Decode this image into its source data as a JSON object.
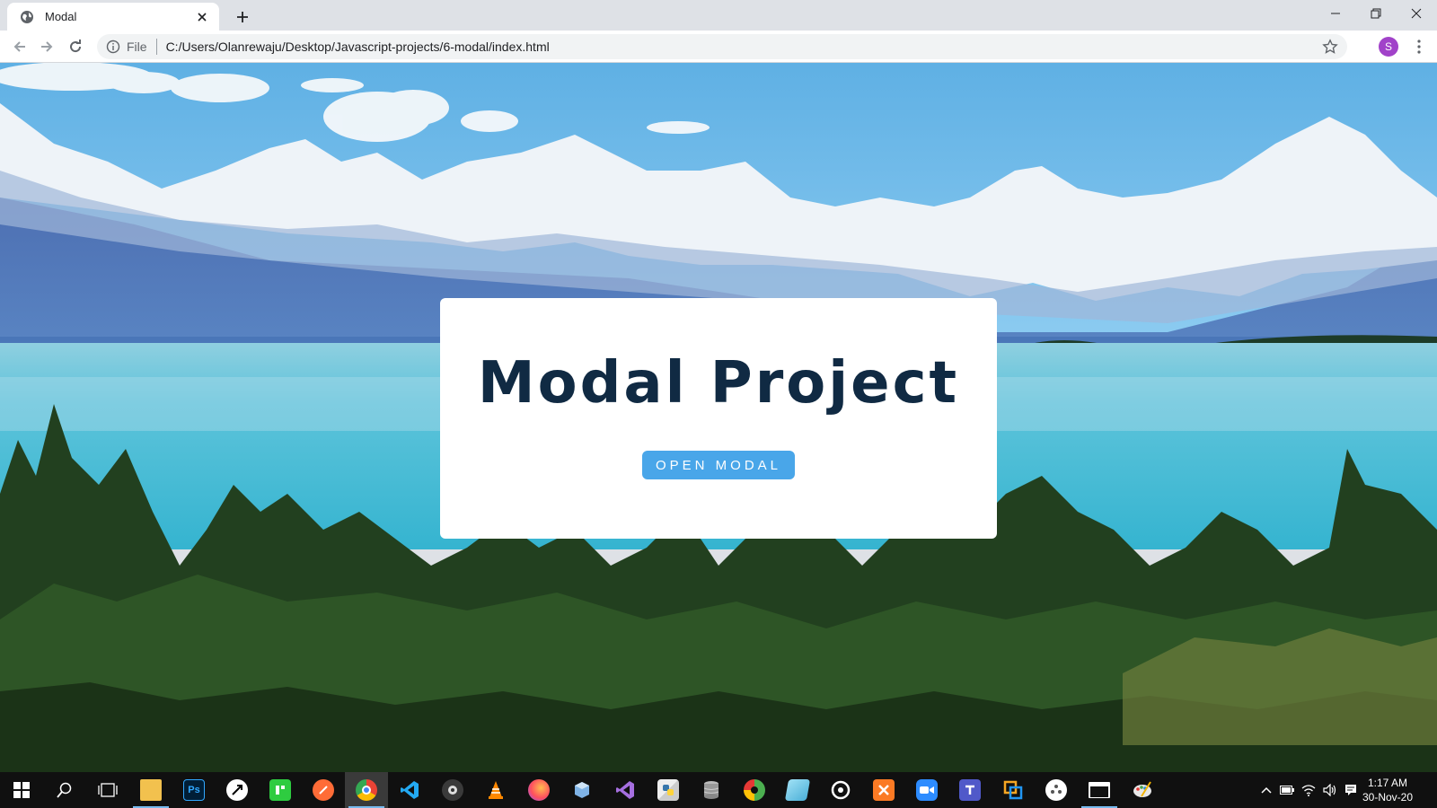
{
  "browser": {
    "tab_title": "Modal",
    "omnibox": {
      "scheme": "File",
      "url": "C:/Users/Olanrewaju/Desktop/Javascript-projects/6-modal/index.html"
    },
    "profile_initial": "S"
  },
  "page": {
    "title": "Modal Project",
    "open_button_label": "OPEN MODAL",
    "colors": {
      "title": "#102a43",
      "button": "#49a6e9",
      "card": "#ffffff"
    }
  },
  "taskbar": {
    "apps": [
      "windows-start-icon",
      "search-icon",
      "task-view-icon",
      "file-explorer-icon",
      "photoshop-icon",
      "inkscape-icon",
      "jetbrains-icon",
      "postman-icon",
      "chrome-icon",
      "vscode-icon",
      "obs-icon",
      "vlc-icon",
      "firefox-icon",
      "3d-viewer-icon",
      "visual-studio-icon",
      "python-icon",
      "database-icon",
      "android-studio-icon",
      "notepad-icon",
      "davinci-icon",
      "xampp-icon",
      "zoom-icon",
      "teams-icon",
      "filezilla-icon",
      "video-editor-icon",
      "terminal-icon",
      "paint-icon"
    ],
    "photoshop_label": "Ps",
    "clock": {
      "time": "1:17 AM",
      "date": "30-Nov-20"
    }
  }
}
